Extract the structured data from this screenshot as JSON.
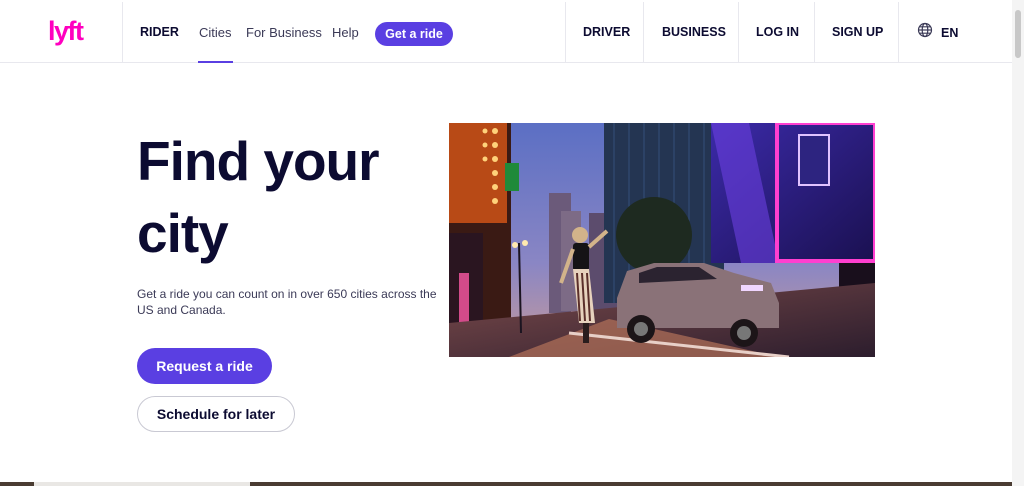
{
  "brand": {
    "logo_text": "lyft",
    "logo_color": "#ff00bf",
    "accent": "#5a3fe2"
  },
  "nav": {
    "left": [
      {
        "label": "RIDER"
      },
      {
        "label": "Cities",
        "active": true
      },
      {
        "label": "For Business"
      },
      {
        "label": "Help"
      }
    ],
    "cta": "Get a ride",
    "right": [
      {
        "label": "DRIVER"
      },
      {
        "label": "BUSINESS"
      },
      {
        "label": "LOG IN"
      },
      {
        "label": "SIGN UP"
      }
    ],
    "language": {
      "icon": "globe-icon",
      "label": "EN"
    }
  },
  "hero": {
    "title_line1": "Find your",
    "title_line2": "city",
    "subtitle": "Get a ride you can count on in over 650 cities across the US and Canada.",
    "primary_button": "Request a ride",
    "secondary_button": "Schedule for later"
  }
}
